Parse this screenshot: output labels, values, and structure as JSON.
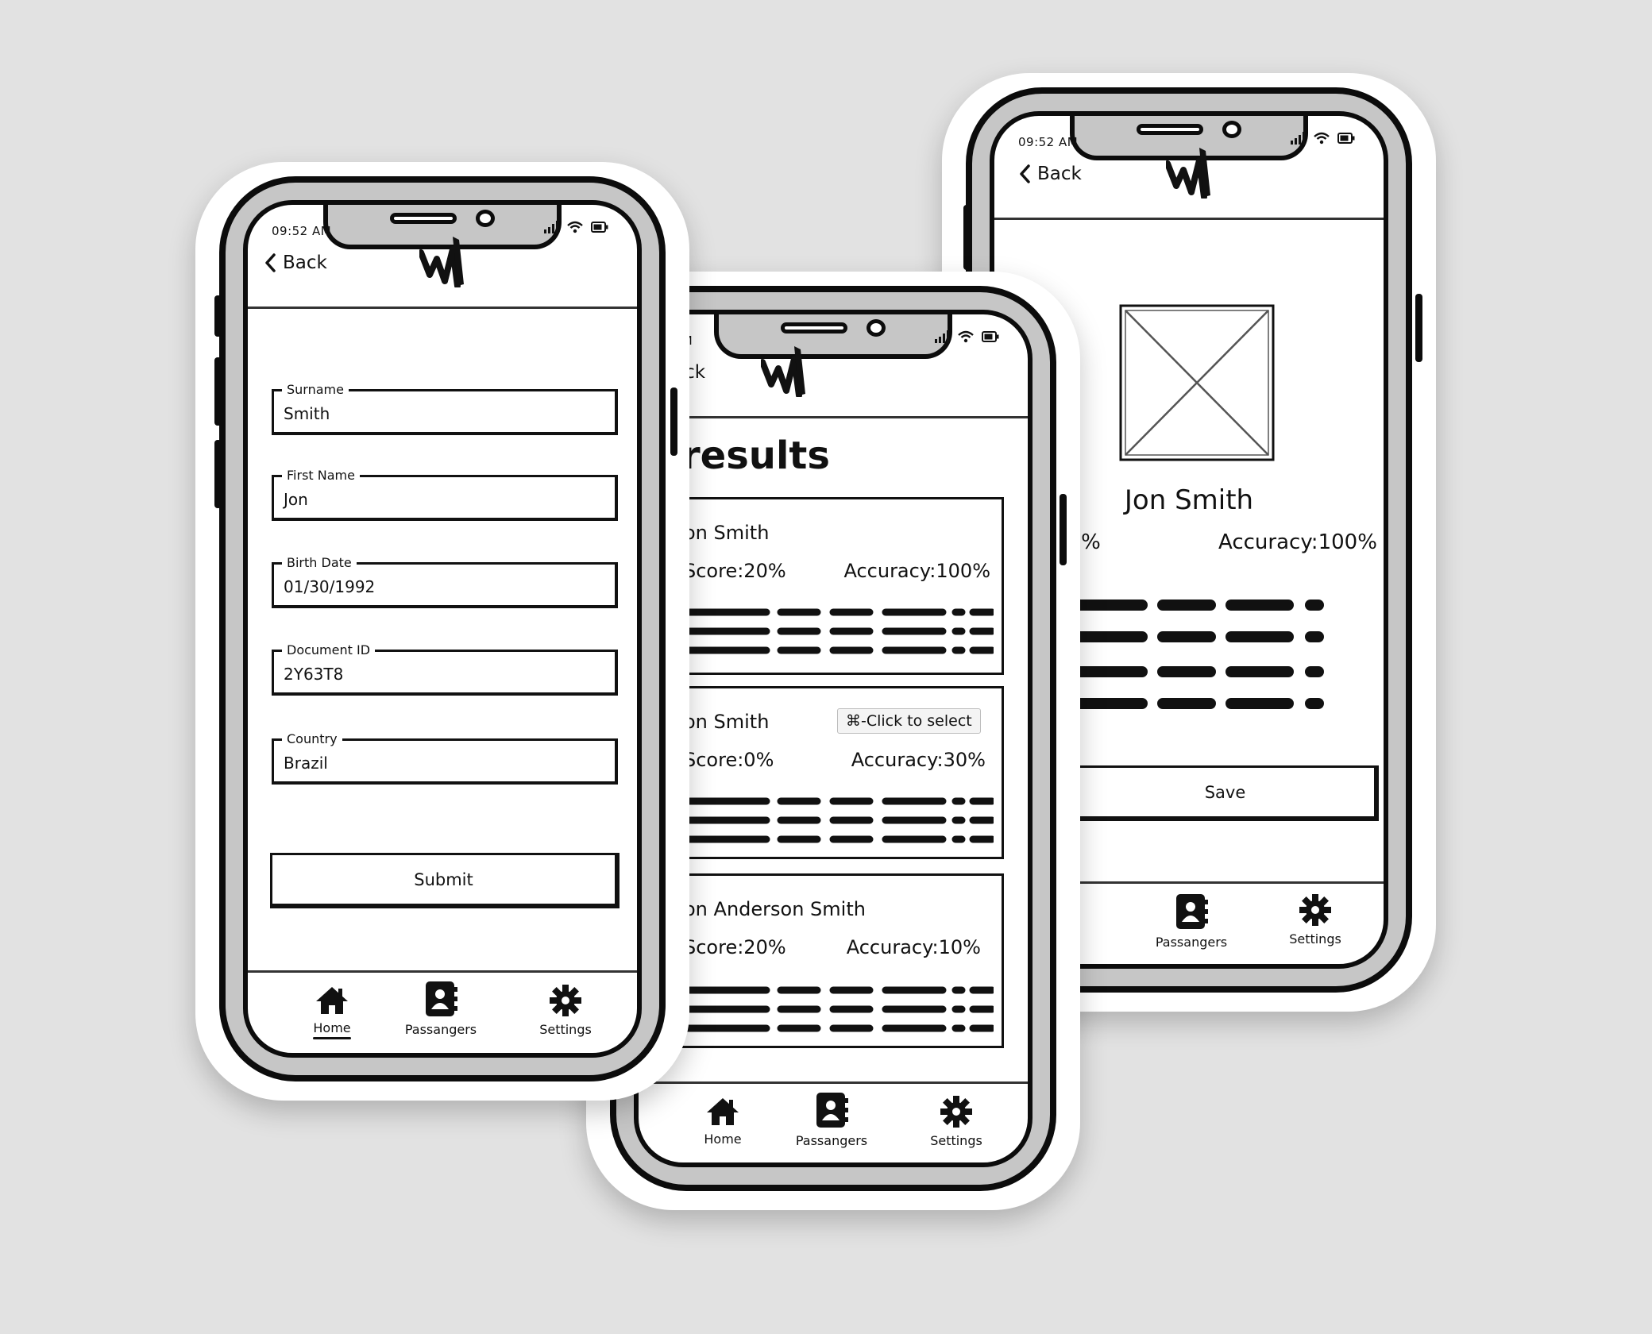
{
  "status": {
    "time": "09:52 AM"
  },
  "nav": {
    "back_label": "Back"
  },
  "form": {
    "fields": [
      {
        "label": "Surname",
        "value": "Smith"
      },
      {
        "label": "First Name",
        "value": "Jon"
      },
      {
        "label": "Birth Date",
        "value": "01/30/1992"
      },
      {
        "label": "Document ID",
        "value": "2Y63T8"
      },
      {
        "label": "Country",
        "value": "Brazil"
      }
    ],
    "submit_label": "Submit"
  },
  "tabs": {
    "home": "Home",
    "passengers": "Passangers",
    "settings": "Settings"
  },
  "results": {
    "back_partial": "ack",
    "time_partial": "AM",
    "title": "results",
    "tooltip": "⌘-Click to select",
    "items": [
      {
        "name": "on Smith",
        "score": "Score:20%",
        "accuracy": "Accuracy:100%"
      },
      {
        "name": "on Smith",
        "score": "Score:0%",
        "accuracy": "Accuracy:30%"
      },
      {
        "name": "on Anderson Smith",
        "score": "Score:20%",
        "accuracy": "Accuracy:10%"
      }
    ]
  },
  "detail": {
    "name": "Jon Smith",
    "score_partial": "20%",
    "accuracy": "Accuracy:100%",
    "save_label": "Save"
  },
  "icons": {
    "back": "chevron-left-icon",
    "logo": "brand-w-logo",
    "home": "home-icon",
    "passengers": "contact-book-icon",
    "settings": "gear-icon",
    "signal": "signal-icon",
    "wifi": "wifi-icon",
    "battery": "battery-icon",
    "image_placeholder": "image-placeholder-icon"
  }
}
